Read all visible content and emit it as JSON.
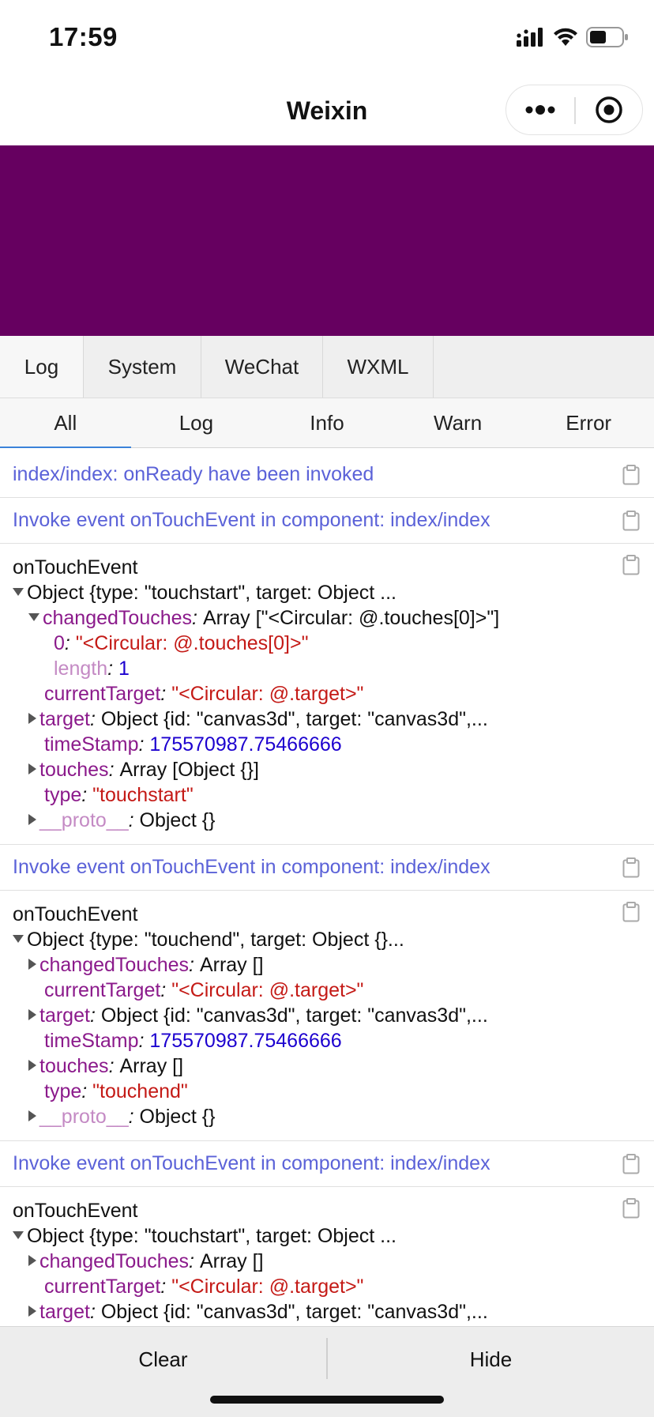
{
  "status_bar": {
    "time": "17:59"
  },
  "nav": {
    "title": "Weixin"
  },
  "tabs_top": [
    "Log",
    "System",
    "WeChat",
    "WXML"
  ],
  "tabs_filter": [
    "All",
    "Log",
    "Info",
    "Warn",
    "Error"
  ],
  "active_filter": "All",
  "canvas": {
    "color": "#660060"
  },
  "logs": {
    "l1": "index/index: onReady have been invoked",
    "l2": "Invoke event onTouchEvent in component: index/index",
    "e1": {
      "title": "onTouchEvent",
      "summary": "Object {type: \"touchstart\", target: Object ...",
      "changedTouches_key": "changedTouches",
      "changedTouches_val": "Array [\"<Circular: @.touches[0]>\"]",
      "idx0_key": "0",
      "idx0_val": "\"<Circular: @.touches[0]>\"",
      "length_key": "length",
      "length_val": "1",
      "currentTarget_key": "currentTarget",
      "currentTarget_val": "\"<Circular: @.target>\"",
      "target_key": "target",
      "target_val": "Object {id: \"canvas3d\", target: \"canvas3d\",...",
      "timeStamp_key": "timeStamp",
      "timeStamp_val": "175570987.75466666",
      "touches_key": "touches",
      "touches_val": "Array [Object {}]",
      "type_key": "type",
      "type_val": "\"touchstart\"",
      "proto_key": "__proto__",
      "proto_val": "Object {}"
    },
    "l3": "Invoke event onTouchEvent in component: index/index",
    "e2": {
      "title": "onTouchEvent",
      "summary": "Object {type: \"touchend\", target: Object {}...",
      "changedTouches_key": "changedTouches",
      "changedTouches_val": "Array []",
      "currentTarget_key": "currentTarget",
      "currentTarget_val": "\"<Circular: @.target>\"",
      "target_key": "target",
      "target_val": "Object {id: \"canvas3d\", target: \"canvas3d\",...",
      "timeStamp_key": "timeStamp",
      "timeStamp_val": "175570987.75466666",
      "touches_key": "touches",
      "touches_val": "Array []",
      "type_key": "type",
      "type_val": "\"touchend\"",
      "proto_key": "__proto__",
      "proto_val": "Object {}"
    },
    "l4": "Invoke event onTouchEvent in component: index/index",
    "e3": {
      "title": "onTouchEvent",
      "summary": "Object {type: \"touchstart\", target: Object ...",
      "changedTouches_key": "changedTouches",
      "changedTouches_val": "Array []",
      "currentTarget_key": "currentTarget",
      "currentTarget_val": "\"<Circular: @.target>\"",
      "target_key": "target",
      "target_val": "Object {id: \"canvas3d\", target: \"canvas3d\",..."
    }
  },
  "footer": {
    "clear": "Clear",
    "hide": "Hide"
  }
}
